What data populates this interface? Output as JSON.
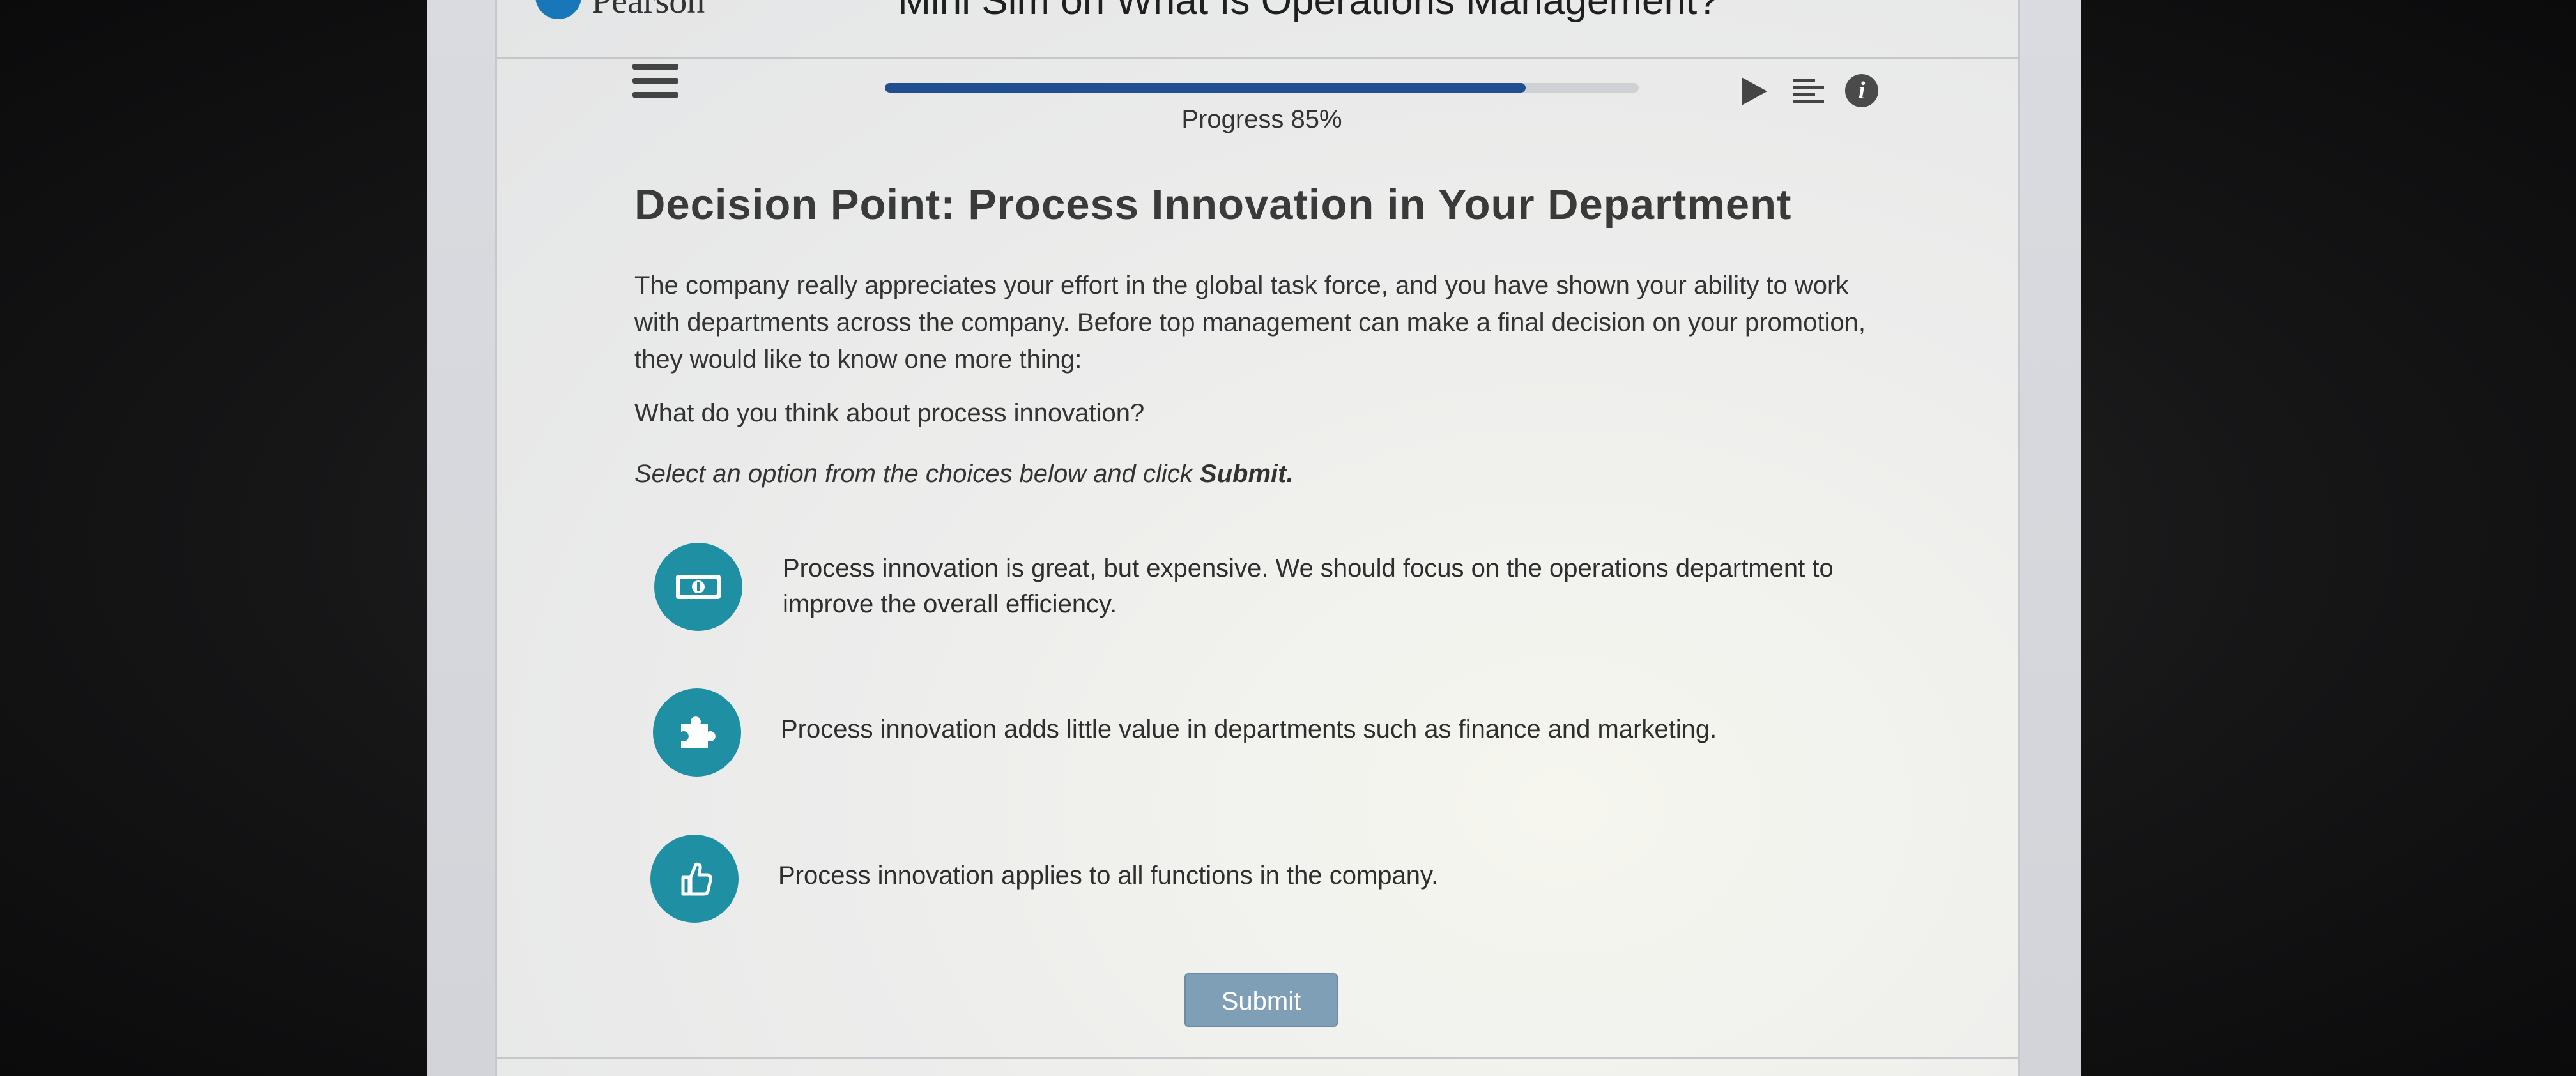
{
  "header": {
    "logo_text": "Pearson",
    "title": "Mini Sim on What Is Operations Management?"
  },
  "progress": {
    "label": "Progress 85%",
    "value_percent": 85
  },
  "icons": {
    "menu": "hamburger-menu-icon",
    "play": "play-icon",
    "transcript": "transcript-icon",
    "info": "info-icon",
    "info_glyph": "i"
  },
  "main": {
    "title": "Decision Point: Process Innovation in Your Department",
    "intro": "The company really appreciates your effort in the global task force, and you have shown your ability to work with departments across the company. Before top management can make a final decision on your promotion, they would like to know one more thing:",
    "question": "What do you think about process innovation?",
    "instruction_prefix": "Select an option from the choices below and click ",
    "instruction_bold": "Submit."
  },
  "options": [
    {
      "icon": "money-icon",
      "text": "Process innovation is great, but expensive. We should focus on the operations department to improve the overall efficiency."
    },
    {
      "icon": "puzzle-piece-icon",
      "text": "Process innovation adds little value in departments such as finance and marketing."
    },
    {
      "icon": "thumbs-up-icon",
      "text": "Process innovation applies to all functions in the company."
    }
  ],
  "submit_label": "Submit",
  "colors": {
    "accent_teal": "#1f8fa3",
    "progress_fill": "#1f4f8f",
    "submit_bg": "#7f9fb6"
  }
}
